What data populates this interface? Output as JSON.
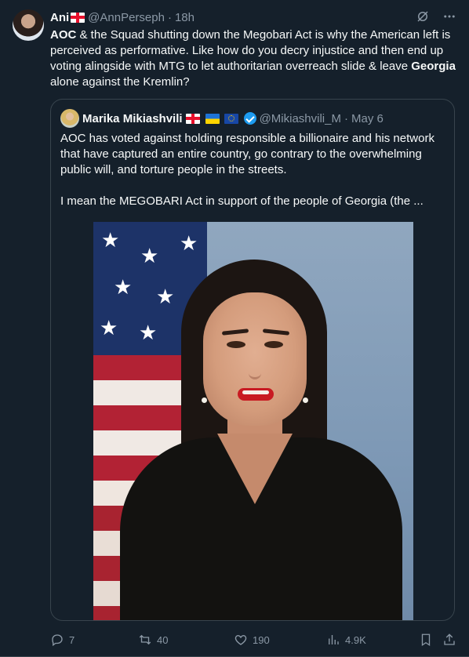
{
  "tweet": {
    "author_name": "Ani",
    "author_handle": "@AnnPerseph",
    "separator": "·",
    "timestamp": "18h",
    "text": {
      "part1_bold": "AOC",
      "part2": " & the Squad shutting down the Megobari Act is why the American left is perceived as performative. Like how do you decry injustice and then end up voting alingside with MTG to let authoritarian overreach slide & leave ",
      "part3_bold": "Georgia",
      "part4": " alone against the Kremlin?"
    }
  },
  "quote": {
    "author_name": "Marika Mikiashvili",
    "author_handle": "@Mikiashvili_M",
    "separator": "·",
    "timestamp": "May 6",
    "paragraph1": "AOC has voted against holding responsible a billionaire and his network that have captured an entire country, go contrary to the overwhelming public will, and torture people in the streets.",
    "paragraph2": "I mean the MEGOBARI Act in support of the people of Georgia (the ..."
  },
  "actions": {
    "replies": "7",
    "reposts": "40",
    "likes": "190",
    "views": "4.9K"
  },
  "icons": {
    "grok": "grok-icon",
    "more": "more-icon",
    "reply": "reply-icon",
    "repost": "repost-icon",
    "like": "heart-icon",
    "views": "views-icon",
    "bookmark": "bookmark-icon",
    "share": "share-icon"
  },
  "colors": {
    "background": "#15202b",
    "text_primary": "#f7f9f9",
    "text_secondary": "#8b98a5",
    "border": "#38444d",
    "verified": "#1d9bf0"
  }
}
